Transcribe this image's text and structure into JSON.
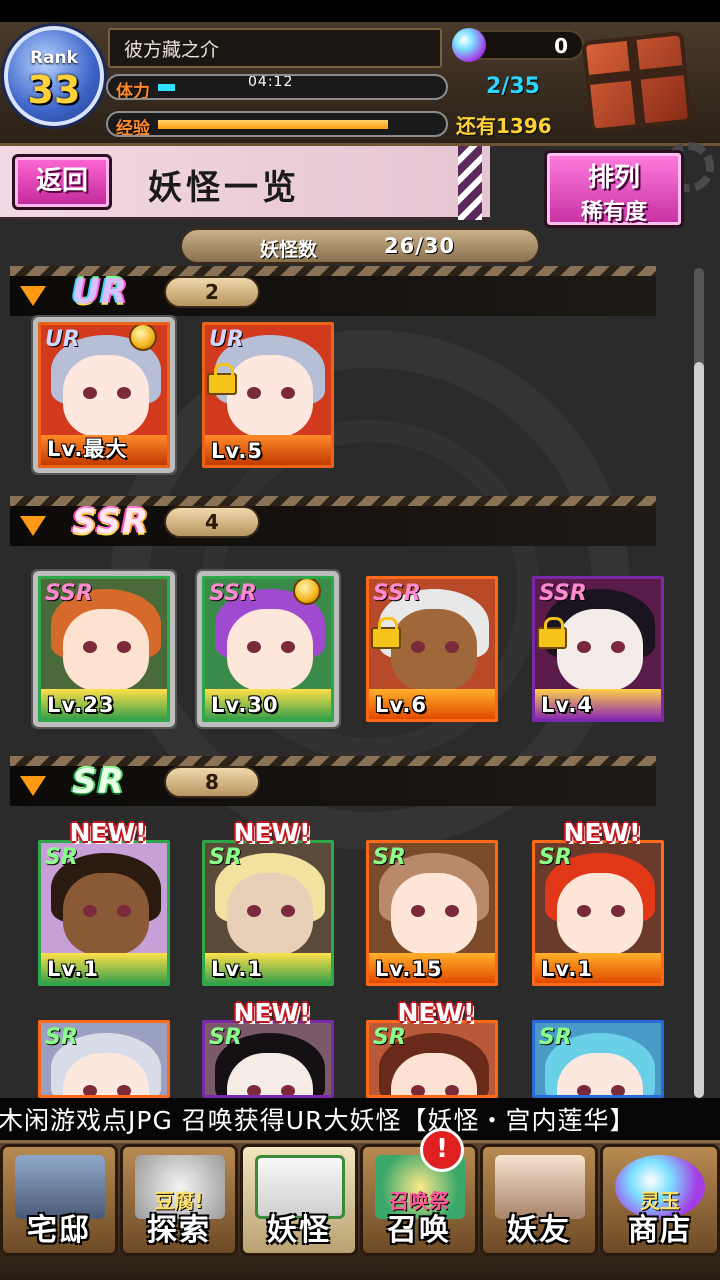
{
  "header": {
    "rank_label": "Rank",
    "rank_value": "33",
    "player_name": "彼方藏之介",
    "gems": "0",
    "stamina_label": "体力",
    "stamina_timer": "04:12",
    "stamina_count": "2/35",
    "stamina_fraction": 0.06,
    "exp_label": "经验",
    "exp_remaining": "还有1396",
    "exp_fraction": 0.82
  },
  "titlebar": {
    "back_label": "返回",
    "title": "妖怪一览",
    "sort_line1": "排列",
    "sort_line2": "稀有度"
  },
  "summary": {
    "label": "妖怪数",
    "value": "26/30"
  },
  "sections": [
    {
      "rarity": "UR",
      "count": "2",
      "cards": [
        {
          "rarity": "UR",
          "level": "Lv.最大",
          "medal": true,
          "lock": false,
          "new": false
        },
        {
          "rarity": "UR",
          "level": "Lv.5",
          "medal": false,
          "lock": true,
          "new": false
        }
      ]
    },
    {
      "rarity": "SSR",
      "count": "4",
      "cards": [
        {
          "rarity": "SSR",
          "level": "Lv.23",
          "medal": false,
          "lock": false,
          "new": false
        },
        {
          "rarity": "SSR",
          "level": "Lv.30",
          "medal": true,
          "lock": false,
          "new": false
        },
        {
          "rarity": "SSR",
          "level": "Lv.6",
          "medal": false,
          "lock": true,
          "new": false
        },
        {
          "rarity": "SSR",
          "level": "Lv.4",
          "medal": false,
          "lock": true,
          "new": false
        }
      ]
    },
    {
      "rarity": "SR",
      "count": "8",
      "cards": [
        {
          "rarity": "SR",
          "level": "Lv.1",
          "medal": false,
          "lock": false,
          "new": true
        },
        {
          "rarity": "SR",
          "level": "Lv.1",
          "medal": false,
          "lock": false,
          "new": true
        },
        {
          "rarity": "SR",
          "level": "Lv.15",
          "medal": false,
          "lock": false,
          "new": false
        },
        {
          "rarity": "SR",
          "level": "Lv.1",
          "medal": false,
          "lock": false,
          "new": true
        },
        {
          "rarity": "SR",
          "level": "",
          "medal": false,
          "lock": false,
          "new": false
        },
        {
          "rarity": "SR",
          "level": "",
          "medal": false,
          "lock": false,
          "new": true
        },
        {
          "rarity": "SR",
          "level": "",
          "medal": false,
          "lock": false,
          "new": true
        },
        {
          "rarity": "SR",
          "level": "",
          "medal": false,
          "lock": false,
          "new": false
        }
      ]
    }
  ],
  "new_tag": "NEW!",
  "ticker": "木闲游戏点JPG 召唤获得UR大妖怪【妖怪・宫内莲华】",
  "nav": {
    "items": [
      {
        "label": "宅邸",
        "sub": ""
      },
      {
        "label": "探索",
        "sub": "豆腐!"
      },
      {
        "label": "妖怪",
        "sub": ""
      },
      {
        "label": "召唤",
        "sub": "召唤祭"
      },
      {
        "label": "妖友",
        "sub": ""
      },
      {
        "label": "商店",
        "sub": "灵玉"
      }
    ],
    "alert": "!"
  },
  "colors": {
    "accent_pink": "#c02698",
    "exp_orange": "#ff9b14",
    "stamina_cyan": "#30e0ff",
    "rank_gold": "#ffd23a"
  }
}
